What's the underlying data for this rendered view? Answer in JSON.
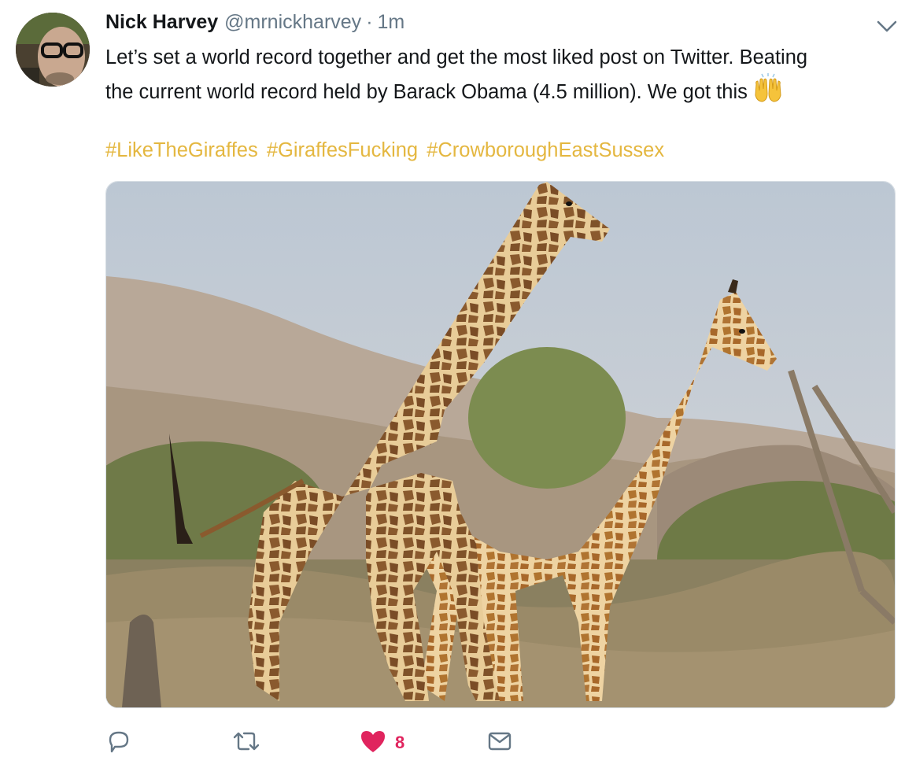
{
  "tweet": {
    "author_name": "Nick Harvey",
    "author_handle": "@mrnickharvey",
    "separator": "·",
    "time": "1m",
    "text_lines": [
      "Let’s set a world record together and get the most liked post on Twitter. Beating",
      "the current world record held by Barack Obama (4.5 million). We got this"
    ],
    "emoji": "raising-hands-emoji",
    "hashtags": [
      "#LikeTheGiraffes",
      "#GiraffesFucking",
      "#CrowboroughEastSussex"
    ],
    "media": {
      "description_icon": "photo-giraffes"
    }
  },
  "actions": {
    "reply_icon": "reply-icon",
    "retweet_icon": "retweet-icon",
    "like_icon": "heart-icon",
    "like_count": "8",
    "dm_icon": "envelope-icon"
  },
  "colors": {
    "hashtag": "#e4b740",
    "like": "#e0245e",
    "secondary_text": "#657786",
    "icon": "#657786"
  }
}
